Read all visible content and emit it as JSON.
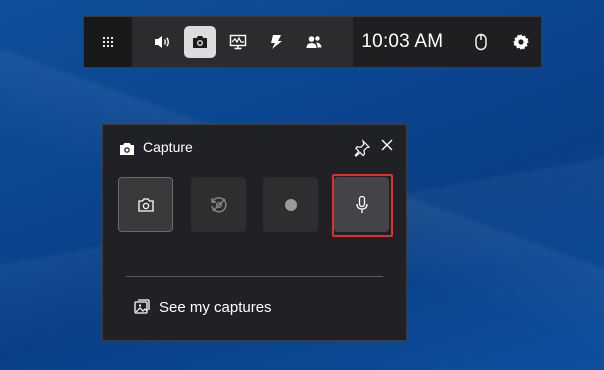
{
  "gamebar": {
    "time": "10:03 AM",
    "widgets": [
      {
        "name": "audio-widget-button",
        "icon": "speaker-icon",
        "active": false
      },
      {
        "name": "capture-widget-button",
        "icon": "camera-icon",
        "active": true
      },
      {
        "name": "performance-widget-button",
        "icon": "monitor-chart-icon",
        "active": false
      },
      {
        "name": "xbox-widget-button",
        "icon": "xbox-icon",
        "active": false
      },
      {
        "name": "social-widget-button",
        "icon": "people-icon",
        "active": false
      }
    ]
  },
  "capture_panel": {
    "title": "Capture",
    "see_captures_label": "See my captures",
    "highlight_color": "#e0302a"
  }
}
